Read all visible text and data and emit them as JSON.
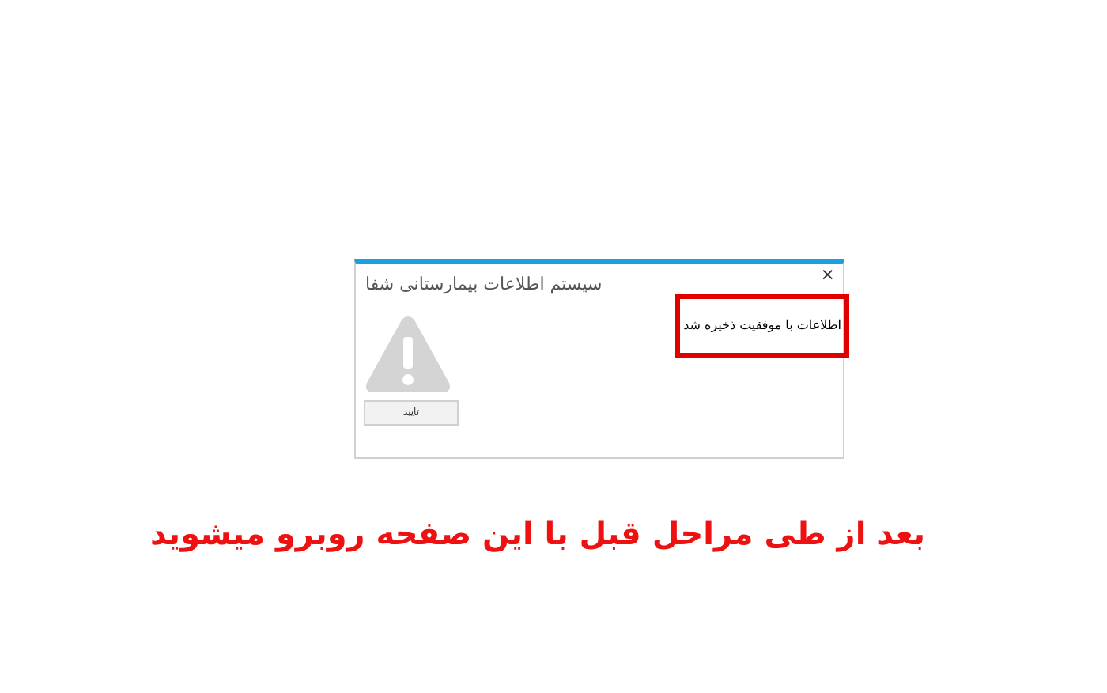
{
  "dialog": {
    "title": "سیستم اطلاعات بیمارستانی شفا",
    "close": "×",
    "message": "اطلاعات با موفقیت ذخیره شد",
    "button": "تایید"
  },
  "caption": "بعد از طی مراحل قبل با این صفحه روبرو میشوید"
}
